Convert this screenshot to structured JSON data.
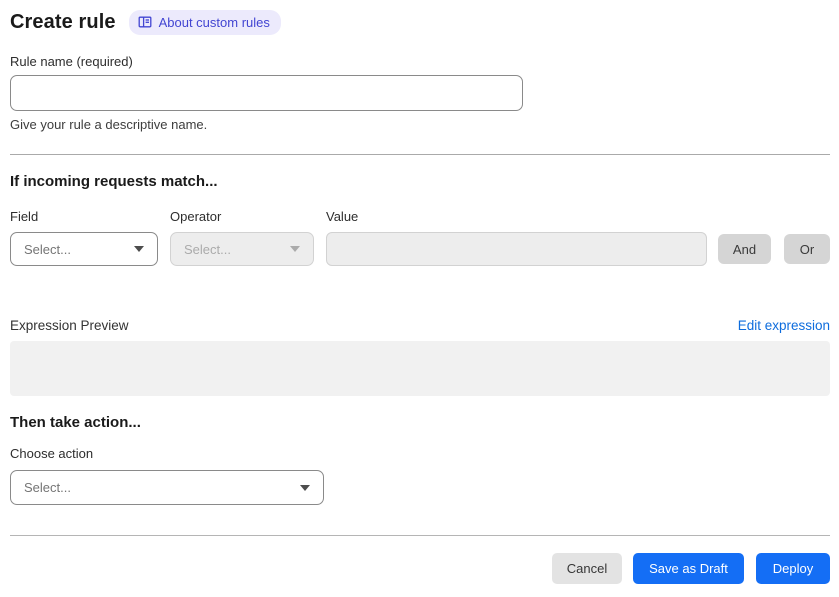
{
  "page": {
    "title": "Create rule",
    "about_link": "About custom rules"
  },
  "rule_name": {
    "label": "Rule name (required)",
    "value": "",
    "helper": "Give your rule a descriptive name."
  },
  "match": {
    "heading": "If incoming requests match...",
    "field": {
      "label": "Field",
      "placeholder": "Select...",
      "disabled": false
    },
    "operator": {
      "label": "Operator",
      "placeholder": "Select...",
      "disabled": true
    },
    "value": {
      "label": "Value",
      "value": "",
      "disabled": true
    },
    "and_label": "And",
    "or_label": "Or",
    "preview_label": "Expression Preview",
    "edit_link": "Edit expression",
    "expression_value": ""
  },
  "action": {
    "heading": "Then take action...",
    "label": "Choose action",
    "placeholder": "Select..."
  },
  "footer": {
    "cancel_label": "Cancel",
    "save_draft_label": "Save as Draft",
    "deploy_label": "Deploy"
  },
  "colors": {
    "primary_blue": "#146ef5",
    "link_blue": "#0d6cdd",
    "badge_bg": "#eceafc",
    "badge_text": "#4245d2",
    "disabled_bg": "#ededed",
    "preview_bg": "#f1f1f1"
  }
}
